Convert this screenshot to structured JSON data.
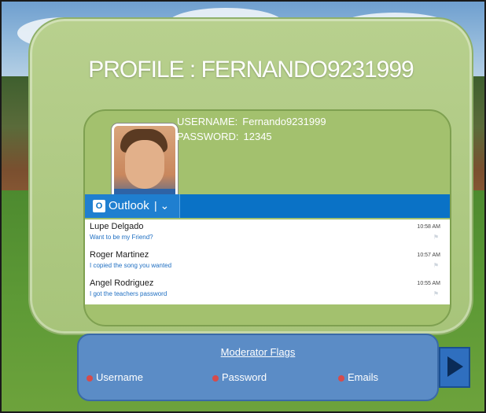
{
  "profile": {
    "title": "PROFILE : FERNANDO9231999",
    "username_label": "USERNAME:",
    "username_value": "Fernando9231999",
    "password_label": "PASSWORD:",
    "password_value": "12345",
    "avatar_icon": "avatar-photo"
  },
  "outlook": {
    "app_label": "Outlook",
    "logo_icon": "outlook-logo-icon",
    "chevron_icon": "chevron-down-icon",
    "accent_color": "#0a72c6",
    "messages": [
      {
        "sender": "Lupe Delgado",
        "subject": "Want to be my Friend?",
        "time": "10:58 AM"
      },
      {
        "sender": "Roger Martinez",
        "subject": "I copied the song you wanted",
        "time": "10:57 AM"
      },
      {
        "sender": "Angel Rodriguez",
        "subject": "I got the teachers password",
        "time": "10:55 AM"
      }
    ]
  },
  "moderator": {
    "title": "Moderator Flags",
    "flags": [
      "Username",
      "Password",
      "Emails"
    ]
  },
  "navigation": {
    "next_icon": "play-arrow-icon"
  }
}
